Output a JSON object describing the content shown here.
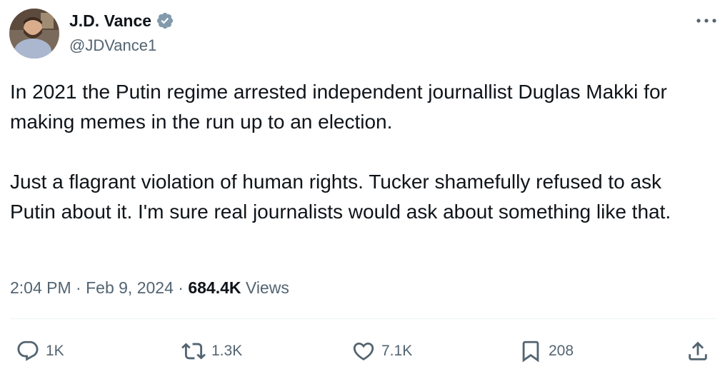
{
  "author": {
    "name": "J.D. Vance",
    "handle": "@JDVance1",
    "verified": true
  },
  "tweet": {
    "paragraphs": [
      "In 2021 the Putin regime arrested independent journallist Duglas Makki for making memes in the run up to an election.",
      "Just a flagrant violation of human rights. Tucker shamefully refused to ask Putin about it. I'm sure real journalists would ask about something like that."
    ],
    "time": "2:04 PM",
    "separator": "·",
    "date": "Feb 9, 2024",
    "views_count": "684.4K",
    "views_label": "Views"
  },
  "actions": {
    "replies": "1K",
    "reposts": "1.3K",
    "likes": "7.1K",
    "bookmarks": "208"
  },
  "colors": {
    "text": "#0f1419",
    "secondary": "#536471",
    "verified_badge": "#829aab",
    "divider": "#eff3f4"
  },
  "icons": {
    "more": "more-horizontal-icon",
    "reply": "reply-icon",
    "repost": "repost-icon",
    "like": "heart-icon",
    "bookmark": "bookmark-icon",
    "share": "share-icon",
    "verified": "verified-badge-icon"
  }
}
